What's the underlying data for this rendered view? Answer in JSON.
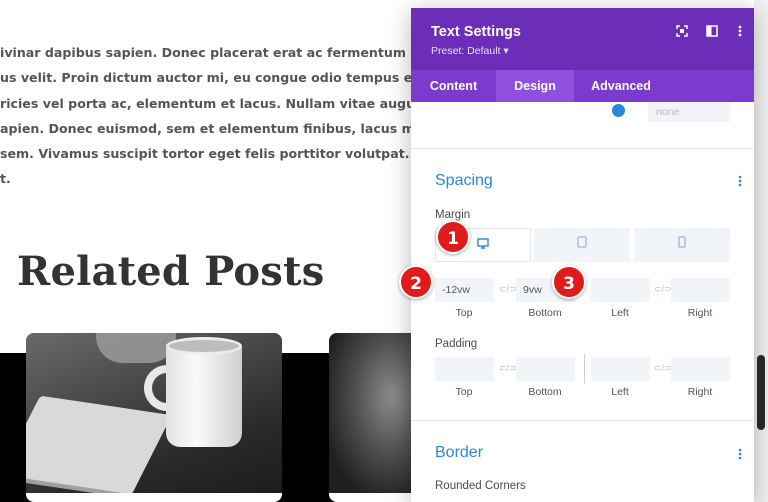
{
  "page": {
    "paragraph_lines": [
      "ivinar dapibus sapien. Donec placerat erat ac fermentum accumsan",
      "us velit. Proin dictum auctor mi, eu congue odio tempus et. Curabitu",
      "ricies vel porta ac, elementum et lacus. Nullam vitae augue aliquet",
      "apien. Donec euismod, sem et elementum finibus, lacus mauris pulv",
      "sem. Vivamus suscipit tortor eget felis porttitor volutpat. Lorem ips",
      "t."
    ],
    "related_title": "Related Posts"
  },
  "panel": {
    "title": "Text Settings",
    "preset": "Preset: Default ▾",
    "header_icons": [
      "screenshot-icon",
      "split-view-icon",
      "more-icon"
    ],
    "tabs": [
      {
        "label": "Content",
        "active": false
      },
      {
        "label": "Design",
        "active": true
      },
      {
        "label": "Advanced",
        "active": false
      }
    ],
    "slider_value_placeholder": "none",
    "spacing": {
      "title": "Spacing",
      "margin_label": "Margin",
      "devices": [
        "desktop-icon",
        "tablet-icon",
        "phone-icon"
      ],
      "margin": {
        "top": "-12vw",
        "bottom": "9vw",
        "left": "",
        "right": ""
      },
      "labels": {
        "top": "Top",
        "bottom": "Bottom",
        "left": "Left",
        "right": "Right"
      },
      "padding_label": "Padding"
    },
    "border": {
      "title": "Border",
      "rounded_corners_label": "Rounded Corners"
    }
  },
  "badges": [
    "1",
    "2",
    "3"
  ],
  "colors": {
    "header": "#6c2eb9",
    "tabs": "#7d3ace",
    "active_tab": "#8f4fdf",
    "accent": "#2b87da",
    "badge": "#e01b1b"
  }
}
